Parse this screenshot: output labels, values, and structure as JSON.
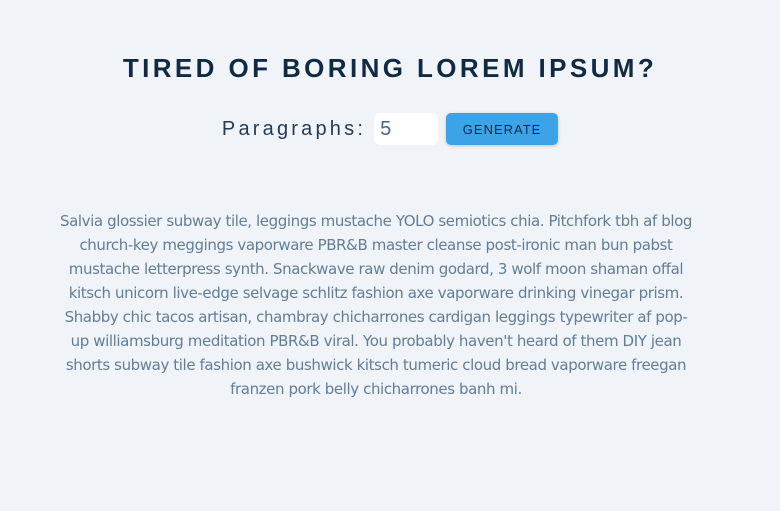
{
  "header": {
    "title": "TIRED OF BORING LOREM IPSUM?"
  },
  "form": {
    "paragraphs_label": "Paragraphs:",
    "paragraphs_value": "5",
    "generate_label": "GENERATE"
  },
  "result": {
    "paragraphs": [
      "Salvia glossier subway tile, leggings mustache YOLO semiotics chia. Pitchfork tbh af blog church-key meggings vaporware PBR&B master cleanse post-ironic man bun pabst mustache letterpress synth. Snackwave raw denim godard, 3 wolf moon shaman offal kitsch unicorn live-edge selvage schlitz fashion axe vaporware drinking vinegar prism. Shabby chic tacos artisan, chambray chicharrones cardigan leggings typewriter af pop-up williamsburg meditation PBR&B viral. You probably haven't heard of them DIY jean shorts subway tile fashion axe bushwick kitsch tumeric cloud bread vaporware freegan franzen pork belly chicharrones banh mi."
    ]
  },
  "colors": {
    "background": "#f0f4f8",
    "title": "#102a43",
    "button": "#3ca3e6",
    "body_text": "#627d98"
  }
}
